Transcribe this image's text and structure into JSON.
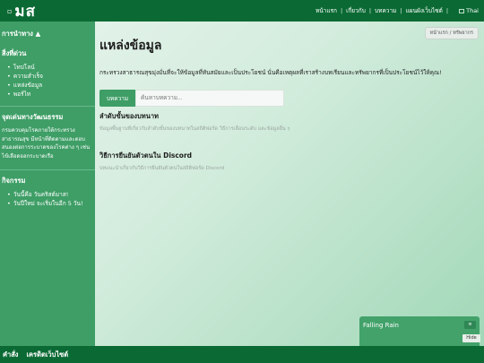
{
  "header": {
    "logo_text": "มส",
    "nav": [
      "หน้าแรก",
      "เกี่ยวกับ",
      "บทความ",
      "แผนผังเว็บไซต์"
    ],
    "language": "Thai"
  },
  "sidebar": {
    "menu_toggle": "การนำทาง ▲",
    "sections": [
      {
        "title": "สิ่งที่ด่วน",
        "items": [
          "โทปโลน์",
          "ความสำเร็จ",
          "แหล่งข้อมูล",
          "พอร์ไท"
        ]
      },
      {
        "title": "จุดเด่นทางวัฒนธรรม",
        "text": "กรมควบคุมโรคภายใต้กระทรวงสาธารณสุข มีหน้าที่ติดตามและตอบสนองต่อการระบาดของโรคต่าง ๆ เช่น ไข้เลือดออกระบาดเรือ"
      },
      {
        "title": "กิจกรรม",
        "items": [
          "วันนี้คือ วันคริสต์มาส!",
          "วันปีใหม่ จะเริ่มในอีก 5 วัน!"
        ]
      }
    ]
  },
  "main": {
    "breadcrumb": "หน้าแรก / ทรัพยากร",
    "title": "แหล่งข้อมูล",
    "intro": "กระทรวงสาธารณสุขมุ่งมั่นที่จะให้ข้อมูลที่ทันสมัยและเป็นประโยชน์ นั่นคือเหตุผลที่เราสร้างบทเรียนและทรัพยากรที่เป็นประโยชน์ไว้ให้คุณ!",
    "search": {
      "button": "บทความ",
      "placeholder": "ค้นหาบทความ..."
    },
    "sections": [
      {
        "title": "ลำดับขั้นของบทนาท",
        "desc": "ข้อมูลพื้นฐานที่เกี่ยวกับลำดับขั้นของบทนาทในสถิติฟอร์ด วิธีการเลื่อนระดับ และข้อมูลอื่น ๆ"
      },
      {
        "title": "วิธีการยืนยันตัวตนใน Discord",
        "desc": "บทแนะนำเกี่ยวกับวิธีการยืนยันตัวตนในสถิติฟอร์ด Discord"
      }
    ]
  },
  "music_player": {
    "title": "Falling Rain",
    "hide": "Hide",
    "icons": [
      "menu-icon",
      "previous-icon",
      "play-icon",
      "next-icon"
    ]
  },
  "footer": {
    "links": [
      "คำสั่ง",
      "เครดิตเว็บไซต์"
    ]
  },
  "colors": {
    "primary": "#0b6a34",
    "sidebar": "#3e9e66",
    "accent": "#42a26a"
  }
}
